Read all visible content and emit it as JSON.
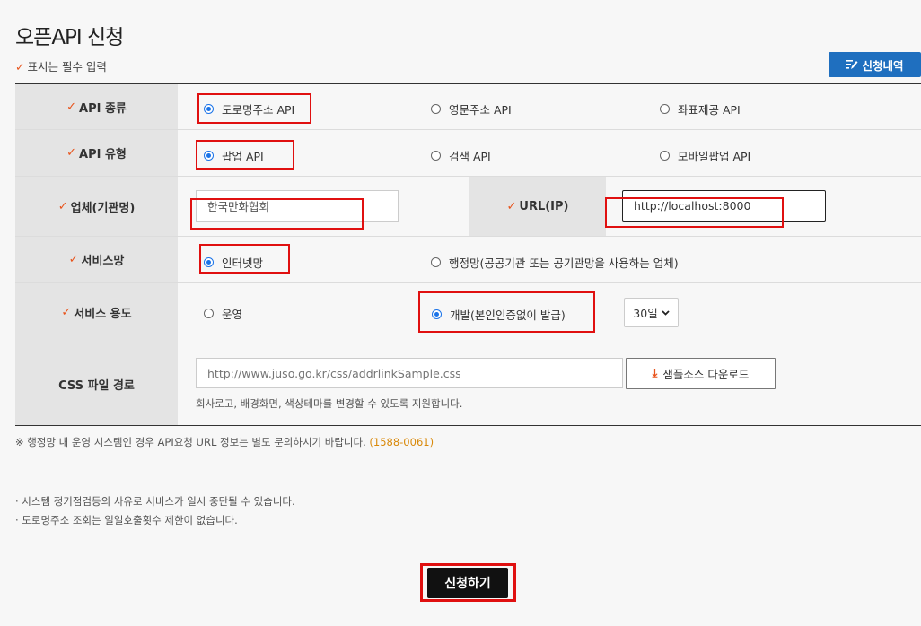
{
  "header": {
    "title": "오픈API 신청",
    "required_note": "표시는 필수 입력",
    "history_button": "신청내역"
  },
  "form": {
    "api_kind": {
      "label": "API 종류",
      "options": [
        "도로명주소 API",
        "영문주소 API",
        "좌표제공 API"
      ],
      "selected": "도로명주소 API"
    },
    "api_type": {
      "label": "API 유형",
      "options": [
        "팝업 API",
        "검색 API",
        "모바일팝업 API"
      ],
      "selected": "팝업 API"
    },
    "company": {
      "label": "업체(기관명)",
      "value": "한국만화협회"
    },
    "url": {
      "label": "URL(IP)",
      "value": "http://localhost:8000"
    },
    "network": {
      "label": "서비스망",
      "options": [
        "인터넷망",
        "행정망(공공기관 또는 공기관망을 사용하는 업체)"
      ],
      "selected": "인터넷망"
    },
    "usage": {
      "label": "서비스 용도",
      "options": [
        "운영",
        "개발(본인인증없이 발급)"
      ],
      "selected": "개발(본인인증없이 발급)",
      "period": "30일"
    },
    "css_path": {
      "label": "CSS 파일 경로",
      "placeholder": "http://www.juso.go.kr/css/addrlinkSample.css",
      "download_button": "샘플소스 다운로드",
      "help": "회사로고, 배경화면, 색상테마를 변경할 수 있도록 지원합니다."
    }
  },
  "notice": {
    "text": "※ 행정망 내 운영 시스템인 경우 API요청 URL 정보는 별도 문의하시기 바랍니다.",
    "phone": "(1588-0061)"
  },
  "bullets": [
    "· 시스템 정기점검등의 사유로 서비스가 일시 중단될 수 있습니다.",
    "· 도로명주소 조회는 일일호출횟수 제한이 없습니다."
  ],
  "submit_label": "신청하기",
  "icons": {
    "required": "check-icon",
    "history": "edit-list-icon",
    "download": "download-icon",
    "select": "chevron-down-icon"
  },
  "colors": {
    "accent": "#1f6fbf",
    "required_mark": "#e8541c",
    "highlight": "#e01010",
    "submit": "#111111"
  }
}
